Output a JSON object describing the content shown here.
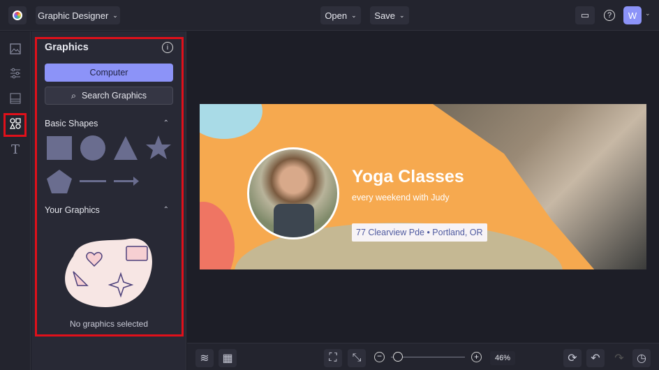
{
  "header": {
    "app_menu": "Graphic Designer",
    "open": "Open",
    "save": "Save",
    "avatar": "W"
  },
  "panel": {
    "title": "Graphics",
    "computer": "Computer",
    "search": "Search Graphics",
    "basic_shapes": "Basic Shapes",
    "your_graphics": "Your Graphics",
    "empty": "No graphics selected"
  },
  "design": {
    "title": "Yoga Classes",
    "subtitle": "every weekend with Judy",
    "address": "77 Clearview Pde • Portland, OR"
  },
  "footer": {
    "zoom": "46%",
    "zoom_fraction": 0.08
  },
  "colors": {
    "accent": "#8c93f8",
    "highlight": "#e0101a",
    "orange": "#f6a94f"
  }
}
